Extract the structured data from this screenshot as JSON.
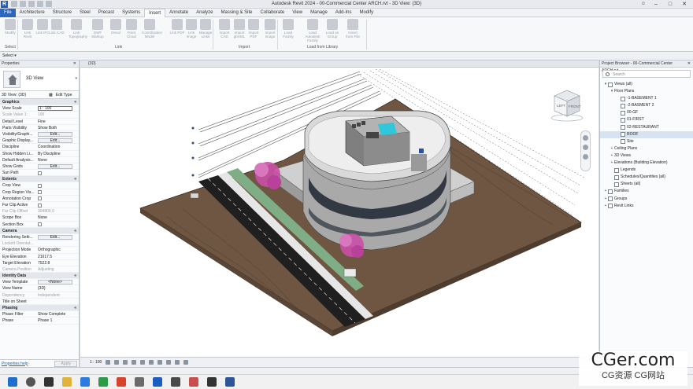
{
  "window": {
    "title": "Autodesk Revit 2024 - 00-Commercial Center ARCH.rvt - 3D View: {3D}"
  },
  "ribbon": {
    "tabs": [
      "File",
      "Architecture",
      "Structure",
      "Steel",
      "Precast",
      "Systems",
      "Insert",
      "Annotate",
      "Analyze",
      "Massing & Site",
      "Collaborate",
      "View",
      "Manage",
      "Add-Ins",
      "Modify"
    ],
    "active_tab": "Insert",
    "tools": [
      {
        "label": "Modify"
      },
      {
        "label": "Link Revit"
      },
      {
        "label": "Link IFC"
      },
      {
        "label": "Link CAD"
      },
      {
        "label": "Link Topography"
      },
      {
        "label": "DWF Markup"
      },
      {
        "label": "Decal"
      },
      {
        "label": "Point Cloud"
      },
      {
        "label": "Coordination Model"
      },
      {
        "label": "Link PDF"
      },
      {
        "label": "Link Image"
      },
      {
        "label": "Manage Links"
      },
      {
        "label": "Import CAD"
      },
      {
        "label": "Import gbXML"
      },
      {
        "label": "Import PDF"
      },
      {
        "label": "Import Image"
      },
      {
        "label": "Load Family"
      },
      {
        "label": "Load Autodesk Family"
      },
      {
        "label": "Load as Group"
      },
      {
        "label": "Insert from File"
      }
    ],
    "groups": [
      "Select",
      "Link",
      "Import",
      "Load from Library"
    ]
  },
  "options_bar": {
    "select_label": "Select ▾"
  },
  "properties": {
    "title": "Properties",
    "type_name": "3D View",
    "instance_selector": "3D View: {3D}",
    "edit_type": "Edit Type",
    "rows": [
      {
        "kind": "group",
        "k": "Graphics"
      },
      {
        "k": "View Scale",
        "v": "1 : 100",
        "style": "box"
      },
      {
        "k": "Scale Value    1:",
        "v": "100",
        "dim": true
      },
      {
        "k": "Detail Level",
        "v": "Fine"
      },
      {
        "k": "Parts Visibility",
        "v": "Show Both"
      },
      {
        "k": "Visibility/Graphi...",
        "v": "Edit...",
        "style": "btn"
      },
      {
        "k": "Graphic Display...",
        "v": "Edit...",
        "style": "btn"
      },
      {
        "k": "Discipline",
        "v": "Coordination"
      },
      {
        "k": "Show Hidden Li...",
        "v": "By Discipline"
      },
      {
        "k": "Default Analysis...",
        "v": "None"
      },
      {
        "k": "Show Grids",
        "v": "Edit...",
        "style": "btn"
      },
      {
        "k": "Sun Path",
        "v": "",
        "style": "chk"
      },
      {
        "kind": "group",
        "k": "Extents"
      },
      {
        "k": "Crop View",
        "v": "",
        "style": "chk"
      },
      {
        "k": "Crop Region Vis...",
        "v": "",
        "style": "chk"
      },
      {
        "k": "Annotation Crop",
        "v": "",
        "style": "chk"
      },
      {
        "k": "Far Clip Active",
        "v": "",
        "style": "chk"
      },
      {
        "k": "Far Clip Offset",
        "v": "304800.0",
        "dim": true
      },
      {
        "k": "Scope Box",
        "v": "None"
      },
      {
        "k": "Section Box",
        "v": "",
        "style": "chk"
      },
      {
        "kind": "group",
        "k": "Camera"
      },
      {
        "k": "Rendering Setti...",
        "v": "Edit...",
        "style": "btn"
      },
      {
        "k": "Locked Orientat...",
        "v": "",
        "dim": true
      },
      {
        "k": "Projection Mode",
        "v": "Orthographic"
      },
      {
        "k": "Eye Elevation",
        "v": "21017.5"
      },
      {
        "k": "Target Elevation",
        "v": "7522.8"
      },
      {
        "k": "Camera Position",
        "v": "Adjusting",
        "dim": true
      },
      {
        "kind": "group",
        "k": "Identity Data"
      },
      {
        "k": "View Template",
        "v": "<None>",
        "style": "btn"
      },
      {
        "k": "View Name",
        "v": "{3D}"
      },
      {
        "k": "Dependency",
        "v": "Independent",
        "dim": true
      },
      {
        "k": "Title on Sheet",
        "v": ""
      },
      {
        "kind": "group",
        "k": "Phasing"
      },
      {
        "k": "Phase Filter",
        "v": "Show Complete"
      },
      {
        "k": "Phase",
        "v": "Phase 1"
      }
    ],
    "help_link": "Properties help",
    "apply": "Apply"
  },
  "view": {
    "tab_label": "{3D}",
    "scale": "1 : 100",
    "viewcube": {
      "left": "LEFT",
      "front": "FRONT"
    }
  },
  "browser": {
    "title": "Project Browser - 00-Commercial Center ARCH.rvt",
    "search_placeholder": "Search",
    "nodes": [
      {
        "t": "Views (all)",
        "lvl": 0,
        "tg": "▾",
        "ic": true
      },
      {
        "t": "Floor Plans",
        "lvl": 1,
        "tg": "▾"
      },
      {
        "t": "-1-BASEMENT 1",
        "lvl": 2,
        "ic": true
      },
      {
        "t": "-2-BASMENT 2",
        "lvl": 2,
        "ic": true
      },
      {
        "t": "00-GF",
        "lvl": 2,
        "ic": true
      },
      {
        "t": "01-FIRST",
        "lvl": 2,
        "ic": true
      },
      {
        "t": "02-RESTAURANT",
        "lvl": 2,
        "ic": true
      },
      {
        "t": "ROOF",
        "lvl": 2,
        "ic": true,
        "sel": true
      },
      {
        "t": "Site",
        "lvl": 2,
        "ic": true
      },
      {
        "t": "Ceiling Plans",
        "lvl": 1,
        "tg": "+"
      },
      {
        "t": "3D Views",
        "lvl": 1,
        "tg": "+"
      },
      {
        "t": "Elevations (Building Elevation)",
        "lvl": 1,
        "tg": "+"
      },
      {
        "t": "Legends",
        "lvl": 1,
        "ic": true
      },
      {
        "t": "Schedules/Quantities (all)",
        "lvl": 1,
        "ic": true
      },
      {
        "t": "Sheets (all)",
        "lvl": 1,
        "ic": true
      },
      {
        "t": "Families",
        "lvl": 0,
        "tg": "+",
        "ic": true
      },
      {
        "t": "Groups",
        "lvl": 0,
        "tg": "+",
        "ic": true
      },
      {
        "t": "Revit Links",
        "lvl": 0,
        "tg": "+",
        "ic": true
      }
    ]
  },
  "watermark": {
    "big": "CGer.com",
    "small": "CG资源 CG网站"
  },
  "colors": {
    "accent": "#2b66bf",
    "ground": "#6e5642",
    "tree": "#c94fa6"
  }
}
